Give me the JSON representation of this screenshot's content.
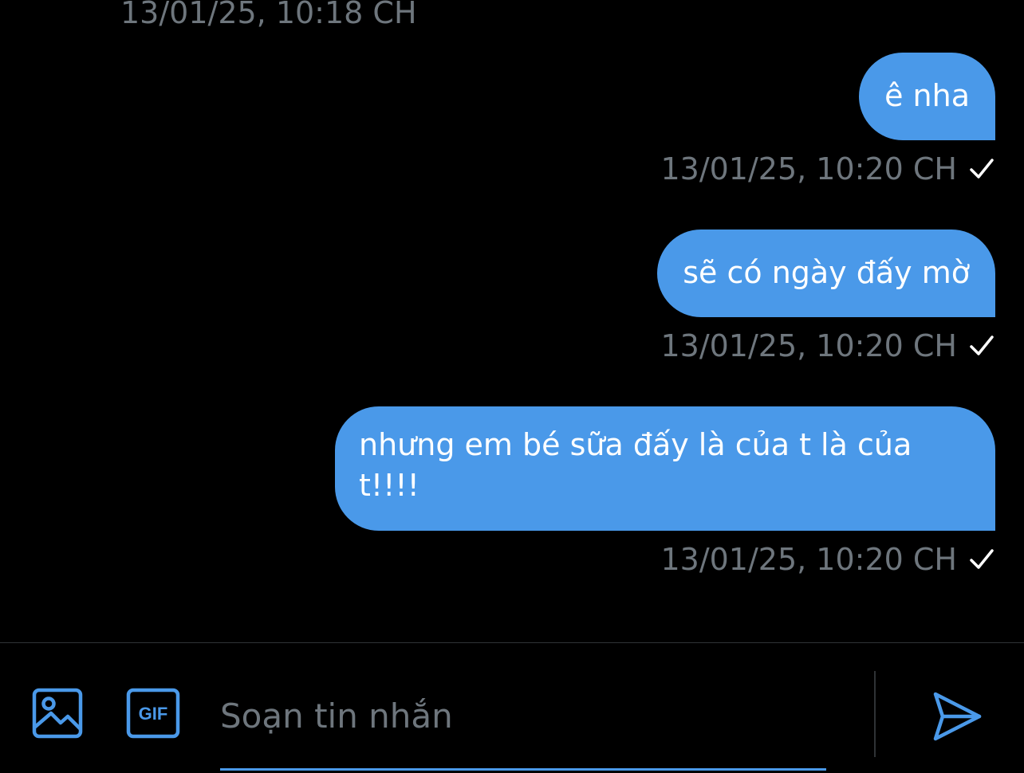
{
  "thread": {
    "previous_timestamp": "13/01/25, 10:18 CH",
    "messages": [
      {
        "text": "ê nha",
        "timestamp": "13/01/25, 10:20 CH",
        "status": "sent"
      },
      {
        "text": "sẽ có ngày đấy mờ",
        "timestamp": "13/01/25, 10:20 CH",
        "status": "sent"
      },
      {
        "text": "nhưng em bé sữa đấy là của t là của t!!!!",
        "timestamp": "13/01/25, 10:20 CH",
        "status": "sent"
      }
    ]
  },
  "composer": {
    "placeholder": "Soạn tin nhắn",
    "value": "",
    "icons": {
      "image": "image-icon",
      "gif": "gif-icon",
      "send": "send-icon"
    },
    "gif_label": "GIF"
  },
  "colors": {
    "background": "#000000",
    "bubble": "#4a99e9",
    "muted_text": "#6e767d",
    "accent": "#4a99e9",
    "divider": "#2f3336"
  }
}
